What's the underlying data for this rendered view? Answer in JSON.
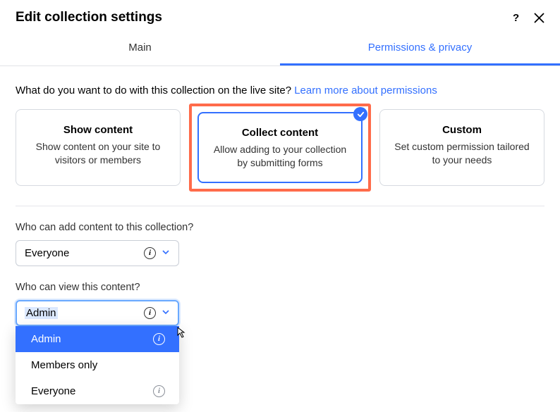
{
  "header": {
    "title": "Edit collection settings",
    "help_icon": "?",
    "close_icon": "✕"
  },
  "tabs": {
    "main": "Main",
    "permissions": "Permissions & privacy"
  },
  "intro": {
    "question": "What do you want to do with this collection on the live site? ",
    "link": "Learn more about permissions"
  },
  "cards": [
    {
      "title": "Show content",
      "desc": "Show content on your site to visitors or members"
    },
    {
      "title": "Collect content",
      "desc": "Allow adding to your collection by submitting forms"
    },
    {
      "title": "Custom",
      "desc": "Set custom permission tailored to your needs"
    }
  ],
  "add_section": {
    "label": "Who can add content to this collection?",
    "value": "Everyone"
  },
  "view_section": {
    "label": "Who can view this content?",
    "value": "Admin",
    "options": [
      "Admin",
      "Members only",
      "Everyone"
    ]
  },
  "icons": {
    "info": "i",
    "chevron_down": "⌄"
  }
}
